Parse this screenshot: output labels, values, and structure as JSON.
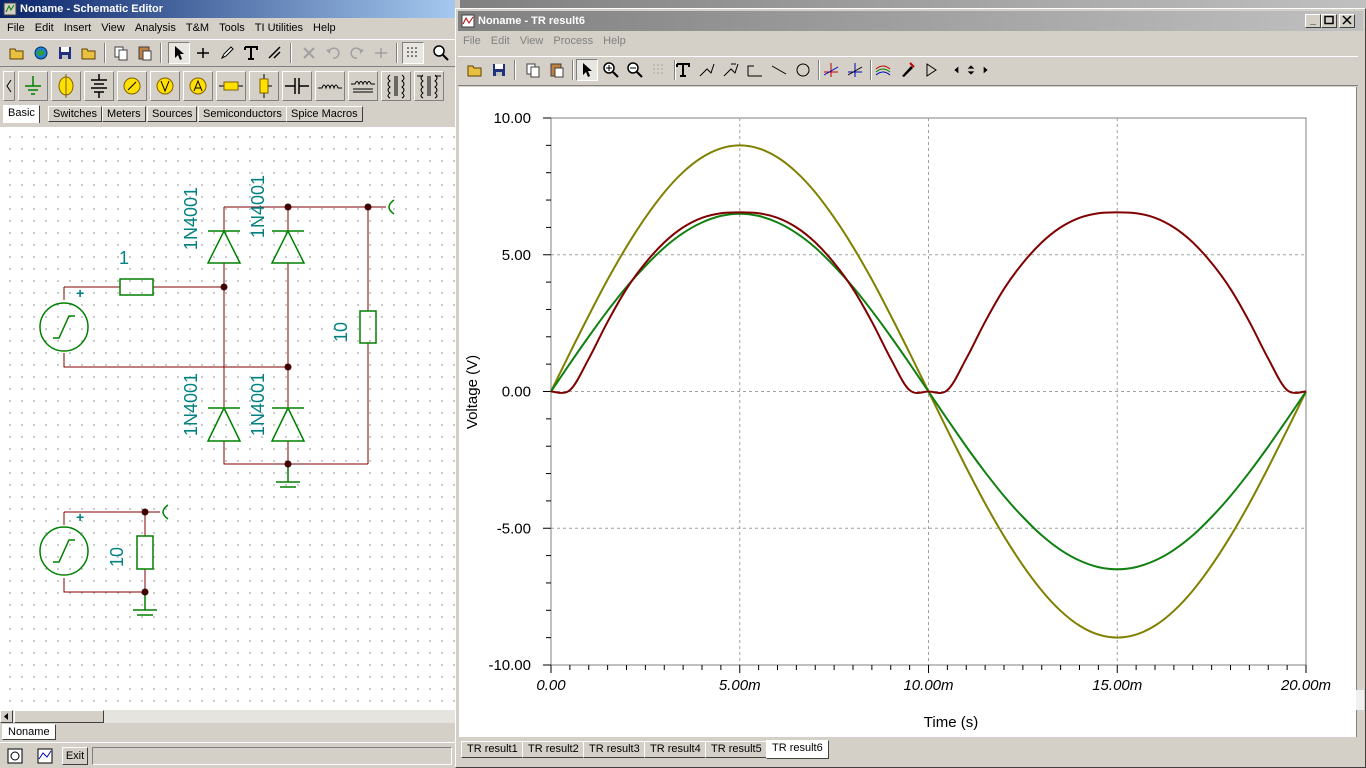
{
  "schematic_window": {
    "title": "Noname - Schematic Editor",
    "menu": [
      "File",
      "Edit",
      "Insert",
      "View",
      "Analysis",
      "T&M",
      "Tools",
      "TI Utilities",
      "Help"
    ],
    "palette_tabs": [
      "Basic",
      "Switches",
      "Meters",
      "Sources",
      "Semiconductors",
      "Spice Macros"
    ],
    "active_palette_tab": "Basic",
    "bottom_tab": "Noname",
    "exit_label": "Exit",
    "components": {
      "series_resistor": "1",
      "diode_top_left": "1N4001",
      "diode_top_right": "1N4001",
      "diode_bottom_left": "1N4001",
      "diode_bottom_right": "1N4001",
      "load_resistor": "10",
      "second_load_resistor": "10",
      "source_plus": "+"
    }
  },
  "result_window": {
    "title": "Noname - TR result6",
    "menu": [
      "File",
      "Edit",
      "View",
      "Process",
      "Help"
    ],
    "tabs": [
      "TR result1",
      "TR result2",
      "TR result3",
      "TR result4",
      "TR result5",
      "TR result6"
    ],
    "active_tab": "TR result6"
  },
  "colors": {
    "title_active": "#0a246a",
    "series_olive": "#808000",
    "series_green": "#108010",
    "series_maroon": "#800000",
    "component_green": "#008000",
    "label_teal": "#008080",
    "wire": "#800000"
  },
  "chart_data": {
    "type": "line",
    "xlabel": "Time (s)",
    "ylabel": "Voltage (V)",
    "xlim": [
      0,
      0.02
    ],
    "ylim": [
      -10,
      10
    ],
    "grid": true,
    "x_ticks": [
      "0.00",
      "5.00m",
      "10.00m",
      "15.00m",
      "20.00m"
    ],
    "y_ticks": [
      "10.00",
      "5.00",
      "0.00",
      "-5.00",
      "-10.00"
    ],
    "x": [
      0,
      0.0005,
      0.001,
      0.0015,
      0.002,
      0.0025,
      0.003,
      0.0035,
      0.004,
      0.0045,
      0.005,
      0.0055,
      0.006,
      0.0065,
      0.007,
      0.0075,
      0.008,
      0.0085,
      0.009,
      0.0095,
      0.01,
      0.0105,
      0.011,
      0.0115,
      0.012,
      0.0125,
      0.013,
      0.0135,
      0.014,
      0.0145,
      0.015,
      0.0155,
      0.016,
      0.0165,
      0.017,
      0.0175,
      0.018,
      0.0185,
      0.019,
      0.0195,
      0.02
    ],
    "series": [
      {
        "color": "#808000",
        "values": [
          0,
          1.41,
          2.78,
          4.09,
          5.29,
          6.36,
          7.28,
          8.02,
          8.56,
          8.89,
          9.0,
          8.89,
          8.56,
          8.02,
          7.28,
          6.36,
          5.29,
          4.09,
          2.78,
          1.41,
          0,
          -1.41,
          -2.78,
          -4.09,
          -5.29,
          -6.36,
          -7.28,
          -8.02,
          -8.56,
          -8.89,
          -9.0,
          -8.89,
          -8.56,
          -8.02,
          -7.28,
          -6.36,
          -5.29,
          -4.09,
          -2.78,
          -1.41,
          0
        ]
      },
      {
        "color": "#108010",
        "values": [
          0,
          1.02,
          2.01,
          2.95,
          3.82,
          4.59,
          5.26,
          5.79,
          6.18,
          6.42,
          6.5,
          6.42,
          6.18,
          5.79,
          5.26,
          4.59,
          3.82,
          2.95,
          2.01,
          1.02,
          0,
          -1.02,
          -2.01,
          -2.95,
          -3.82,
          -4.59,
          -5.26,
          -5.79,
          -6.18,
          -6.42,
          -6.5,
          -6.42,
          -6.18,
          -5.79,
          -5.26,
          -4.59,
          -3.82,
          -2.95,
          -2.01,
          -1.02,
          0
        ]
      },
      {
        "color": "#800000",
        "values": [
          0,
          0.05,
          1.2,
          2.55,
          3.75,
          4.7,
          5.45,
          6.0,
          6.35,
          6.52,
          6.55,
          6.52,
          6.35,
          6.0,
          5.45,
          4.7,
          3.75,
          2.55,
          1.2,
          0.05,
          0,
          0.05,
          1.2,
          2.55,
          3.75,
          4.7,
          5.45,
          6.0,
          6.35,
          6.52,
          6.55,
          6.52,
          6.35,
          6.0,
          5.45,
          4.7,
          3.75,
          2.55,
          1.2,
          0.05,
          0
        ]
      }
    ]
  }
}
